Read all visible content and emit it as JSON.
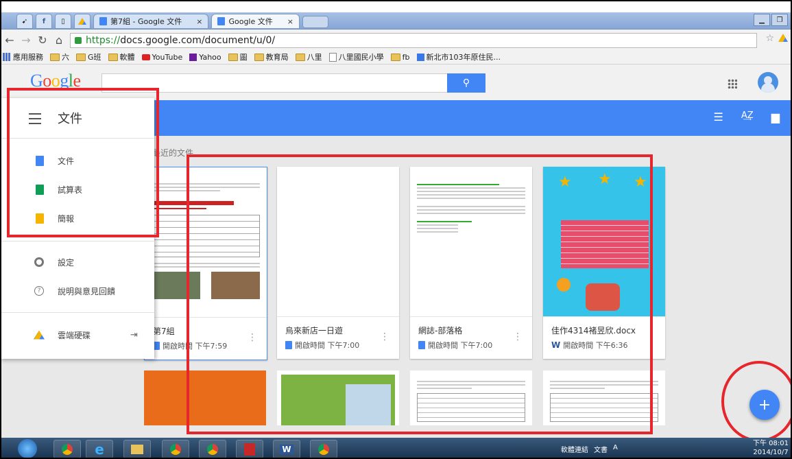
{
  "browser": {
    "tabs": [
      {
        "label": "第7組 - Google 文件",
        "close": "×"
      },
      {
        "label": "Google 文件",
        "close": "×"
      }
    ],
    "url_scheme": "https://",
    "url_rest": "docs.google.com/document/u/0/"
  },
  "bookmarks": [
    {
      "label": "應用服務",
      "icon": "apps-icon"
    },
    {
      "label": "六",
      "icon": "folder-icon"
    },
    {
      "label": "G班",
      "icon": "folder-icon"
    },
    {
      "label": "軟體",
      "icon": "folder-icon"
    },
    {
      "label": "YouTube",
      "icon": "youtube-icon"
    },
    {
      "label": "Yahoo",
      "icon": "yahoo-icon"
    },
    {
      "label": "圖",
      "icon": "folder-icon"
    },
    {
      "label": "教育局",
      "icon": "folder-icon"
    },
    {
      "label": "八里",
      "icon": "folder-icon"
    },
    {
      "label": "八里國民小學",
      "icon": "page-icon"
    },
    {
      "label": "fb",
      "icon": "folder-icon"
    },
    {
      "label": "新北市103年原住民...",
      "icon": "calendar-icon"
    }
  ],
  "google": {
    "logo": "Google",
    "search_icon": "⚲"
  },
  "drawer": {
    "title": "文件",
    "items": [
      {
        "label": "文件",
        "color": "#4285f4"
      },
      {
        "label": "試算表",
        "color": "#0f9d58"
      },
      {
        "label": "簡報",
        "color": "#f4b400"
      }
    ],
    "settings": "設定",
    "help": "說明與意見回饋",
    "drive": "雲端硬碟"
  },
  "recent_label": "最近的文件",
  "files": [
    {
      "name": "第7組",
      "meta": "開啟時間 下午7:59",
      "type": "doc"
    },
    {
      "name": "烏來新店一日遊",
      "meta": "開啟時間 下午7:00",
      "type": "doc"
    },
    {
      "name": "網誌-部落格",
      "meta": "開啟時間 下午7:00",
      "type": "doc"
    },
    {
      "name": "佳作4314褚昱欣.docx",
      "meta": "開啟時間 下午6:36",
      "type": "word"
    }
  ],
  "fab": "+",
  "taskbar": {
    "tray_text": "軟體連結",
    "tray_text2": "文書",
    "tray_ime": "A",
    "time": "下午 08:01",
    "date": "2014/10/7"
  }
}
